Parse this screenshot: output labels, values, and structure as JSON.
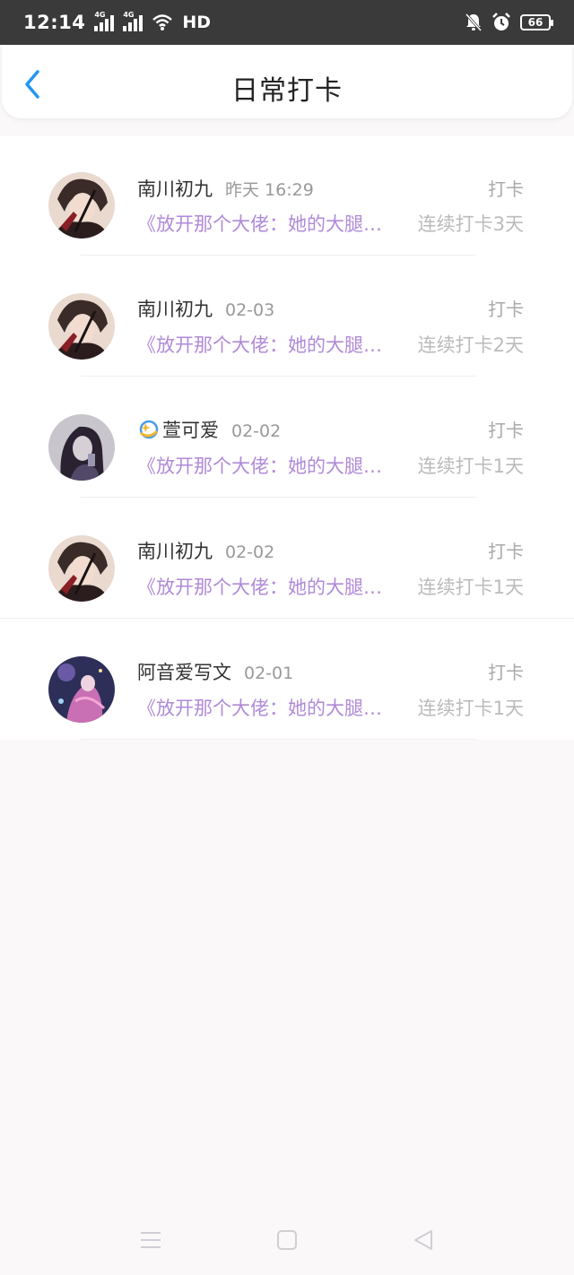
{
  "status_bar": {
    "time": "12:14",
    "network": "4G",
    "network2": "4G",
    "hd": "HD",
    "battery": "66"
  },
  "header": {
    "title": "日常打卡"
  },
  "checkins": [
    {
      "name": "南川初九",
      "date": "昨天 16:29",
      "action": "打卡",
      "book": "《放开那个大佬：她的大腿…",
      "streak": "连续打卡3天"
    },
    {
      "name": "南川初九",
      "date": "02-03",
      "action": "打卡",
      "book": "《放开那个大佬：她的大腿…",
      "streak": "连续打卡2天"
    },
    {
      "name": "萱可爱",
      "date": "02-02",
      "action": "打卡",
      "book": "《放开那个大佬：她的大腿…",
      "streak": "连续打卡1天"
    },
    {
      "name": "南川初九",
      "date": "02-02",
      "action": "打卡",
      "book": "《放开那个大佬：她的大腿…",
      "streak": "连续打卡1天"
    },
    {
      "name": "阿音爱写文",
      "date": "02-01",
      "action": "打卡",
      "book": "《放开那个大佬：她的大腿…",
      "streak": "连续打卡1天"
    }
  ],
  "colors": {
    "accent": "#2196f3",
    "book_title": "#b08ad8",
    "status_bar": "#3a3a3a"
  }
}
